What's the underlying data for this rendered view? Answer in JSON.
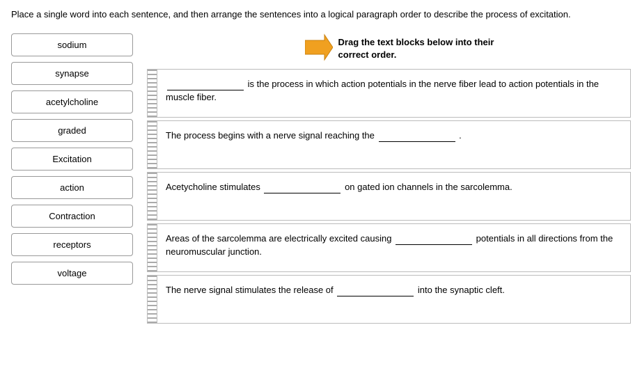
{
  "instruction": "Place a single word into each sentence, and then arrange the sentences into a logical paragraph order to describe the process of excitation.",
  "wordBank": {
    "items": [
      "sodium",
      "synapse",
      "acetylcholine",
      "graded",
      "Excitation",
      "action",
      "Contraction",
      "receptors",
      "voltage"
    ]
  },
  "dragInstruction": {
    "line1": "Drag the text blocks below into their",
    "line2": "correct order."
  },
  "sentences": [
    {
      "id": 1,
      "text_before": "",
      "blank": true,
      "text_after": " is the process in which action potentials in the nerve fiber lead to action potentials in the muscle fiber."
    },
    {
      "id": 2,
      "text_before": "The process begins with a nerve signal reaching the ",
      "blank": true,
      "text_after": " ."
    },
    {
      "id": 3,
      "text_before": "Acetycholine stimulates ",
      "blank": true,
      "text_after": " on gated ion channels in the sarcolemma."
    },
    {
      "id": 4,
      "text_before": "Areas of the sarcolemma are electrically excited causing ",
      "blank": true,
      "text_after": " potentials in all directions from the neuromuscular junction."
    },
    {
      "id": 5,
      "text_before": "The nerve signal stimulates the release of ",
      "blank": true,
      "text_after": " into the synaptic cleft."
    }
  ]
}
